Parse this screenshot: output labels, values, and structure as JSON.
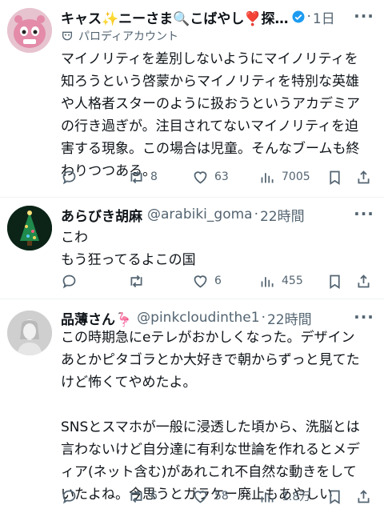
{
  "tweets": [
    {
      "name": "キャス✨ニーさま🔍こばやし❣️探…",
      "time": "1日",
      "parody_label": "パロディアカウント",
      "body": [
        "マイノリティを差別しないようにマイノリティを知ろうという啓蒙からマイノリティを特別な英雄や人格者スターのように扱おうというアカデミアの行き過ぎが。注目されてないマイノリティを迫害する現象。この場合は児童。そんなブームも終わりつつある。"
      ],
      "replies": "",
      "retweets": "8",
      "likes": "63",
      "views": "7005"
    },
    {
      "name": "あらびき胡麻",
      "handle": "@arabiki_goma",
      "time": "22時間",
      "body": [
        "こわ",
        "もう狂ってるよこの国"
      ],
      "replies": "",
      "retweets": "",
      "likes": "6",
      "views": "455"
    },
    {
      "name": "品薄さん🦩",
      "handle": "@pinkcloudinthe1",
      "time": "22時間",
      "body": [
        "この時期急にeテレがおかしくなった。デザインあとかピタゴラとか大好きで朝からずっと見てたけど怖くてやめたよ。",
        "",
        "SNSとスマホが一般に浸透した頃から、洗脳とは言わないけど自分達に有利な世論を作れるとメディア(ネット含む)があれこれ不自然な動きをしていたよね。今思うとガラケー廃止もあやしい"
      ],
      "replies": "",
      "retweets": "6",
      "likes": "58",
      "views": "1.8万"
    }
  ],
  "colors": {
    "text": "#0f1419",
    "muted": "#536471",
    "verified": "#1d9bf0",
    "divider": "#eff3f4"
  }
}
